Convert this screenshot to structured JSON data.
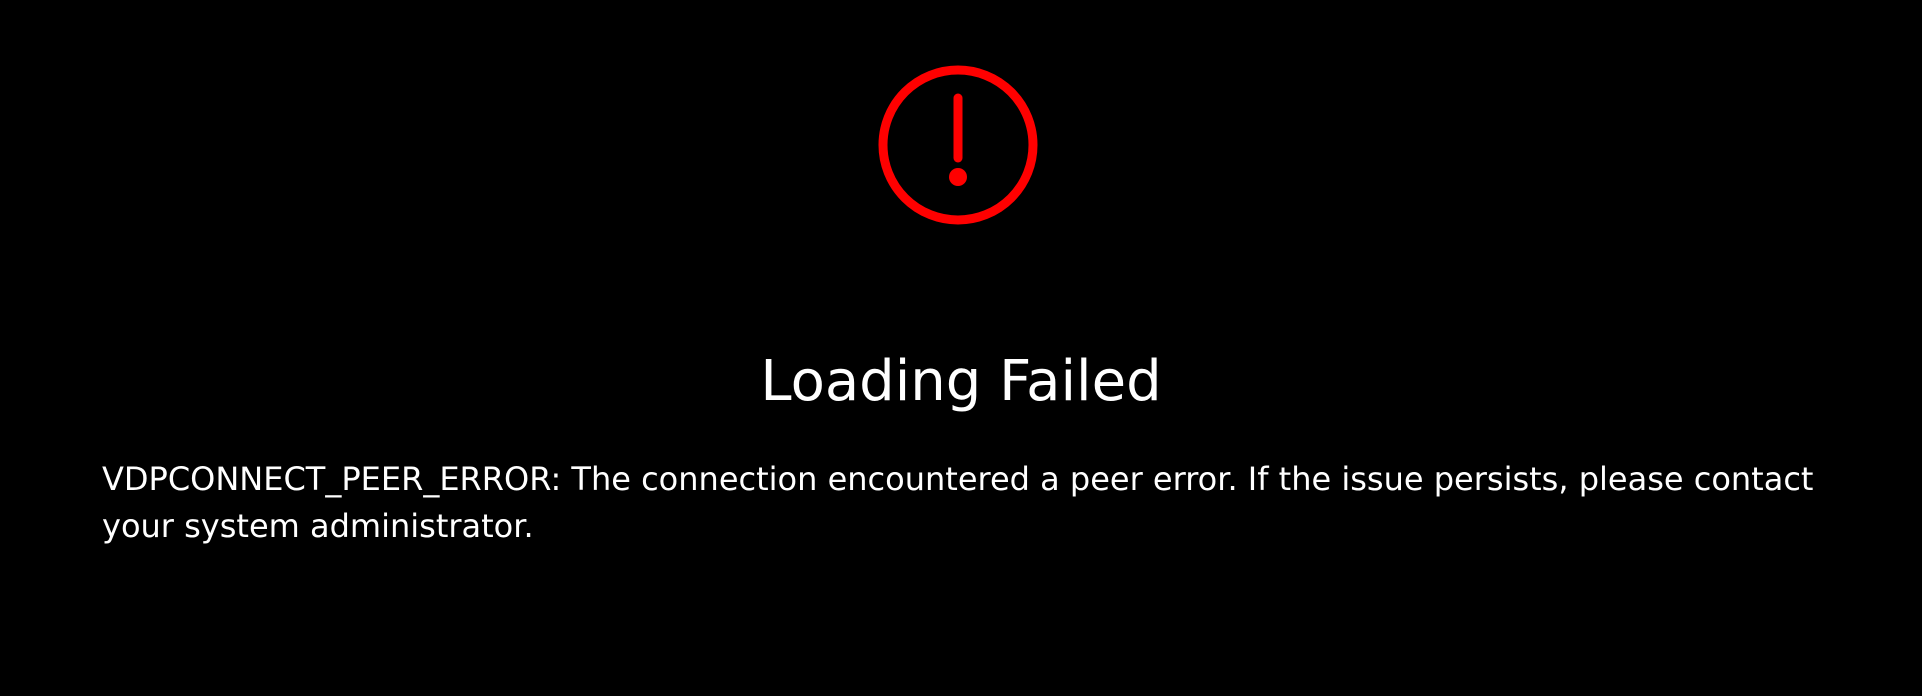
{
  "error": {
    "icon": "exclamation-circle-icon",
    "icon_color": "#ff0000",
    "title": "Loading Failed",
    "message": "VDPCONNECT_PEER_ERROR: The connection encountered a peer error. If the issue persists, please contact your system administrator."
  },
  "colors": {
    "background": "#000000",
    "text": "#ffffff"
  }
}
